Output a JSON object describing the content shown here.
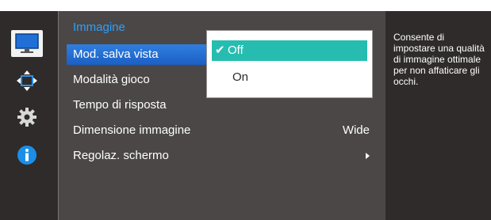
{
  "menu": {
    "title": "Immagine",
    "items": [
      {
        "label": "Mod. salva vista",
        "value": "",
        "active": true
      },
      {
        "label": "Modalità gioco",
        "value": ""
      },
      {
        "label": "Tempo di risposta",
        "value": ""
      },
      {
        "label": "Dimensione immagine",
        "value": "Wide"
      },
      {
        "label": "Regolaz. schermo",
        "value": "",
        "submenu": true
      }
    ]
  },
  "popup": {
    "options": [
      {
        "label": "Off",
        "selected": true
      },
      {
        "label": "On",
        "selected": false
      }
    ],
    "check_glyph": "✔"
  },
  "info": {
    "text": "Consente di impostare una qualità di immagine ottimale per non affaticare gli occhi."
  },
  "sidebar": {
    "icons": [
      {
        "name": "monitor-icon",
        "selected": true
      },
      {
        "name": "resize-arrows-icon"
      },
      {
        "name": "gear-icon"
      },
      {
        "name": "info-icon"
      }
    ]
  },
  "colors": {
    "accent": "#2aa1ff",
    "active_item": "#2f7fe0",
    "popup_selected": "#26bdb0",
    "panel": "#4a4746",
    "side": "#2e2b2a"
  }
}
